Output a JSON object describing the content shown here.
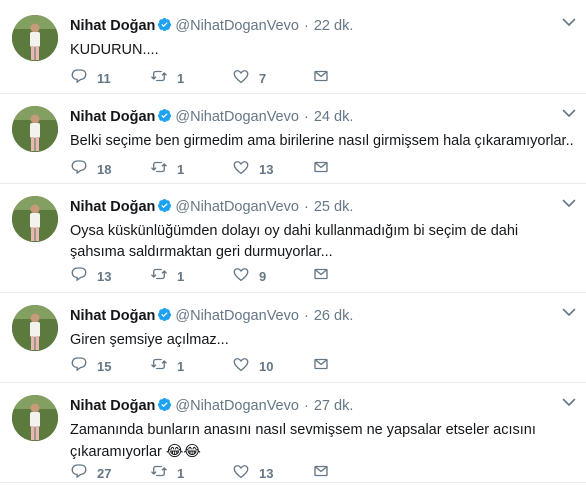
{
  "tweets": [
    {
      "name": "Nihat Doğan",
      "handle": "@NihatDoganVevo",
      "separator": "·",
      "time": "22 dk.",
      "text": "KUDURUN....",
      "replies": "11",
      "retweets": "1",
      "likes": "7"
    },
    {
      "name": "Nihat Doğan",
      "handle": "@NihatDoganVevo",
      "separator": "·",
      "time": "24 dk.",
      "text": "Belki seçime ben girmedim ama birilerine nasıl girmişsem hala çıkaramıyorlar..",
      "replies": "18",
      "retweets": "1",
      "likes": "13"
    },
    {
      "name": "Nihat Doğan",
      "handle": "@NihatDoganVevo",
      "separator": "·",
      "time": "25 dk.",
      "text": "Oysa küskünlüğümden dolayı oy dahi kullanmadığım bi seçim de dahi şahsıma saldırmaktan geri durmuyorlar...",
      "replies": "13",
      "retweets": "1",
      "likes": "9"
    },
    {
      "name": "Nihat Doğan",
      "handle": "@NihatDoganVevo",
      "separator": "·",
      "time": "26 dk.",
      "text": "Giren şemsiye açılmaz...",
      "replies": "15",
      "retweets": "1",
      "likes": "10"
    },
    {
      "name": "Nihat Doğan",
      "handle": "@NihatDoganVevo",
      "separator": "·",
      "time": "27 dk.",
      "text": "Zamanında bunların anasını nasıl sevmişsem ne yapsalar etseler acısını çıkaramıyorlar",
      "emoji": "😂😂",
      "replies": "27",
      "retweets": "1",
      "likes": "13"
    }
  ],
  "icons": {
    "reply": "reply-icon",
    "retweet": "retweet-icon",
    "like": "heart-icon",
    "message": "envelope-icon",
    "verified": "verified-badge-icon",
    "caret": "chevron-down-icon"
  },
  "colors": {
    "verified": "#1da1f2",
    "muted": "#657786",
    "divider": "#e6ecf0"
  }
}
